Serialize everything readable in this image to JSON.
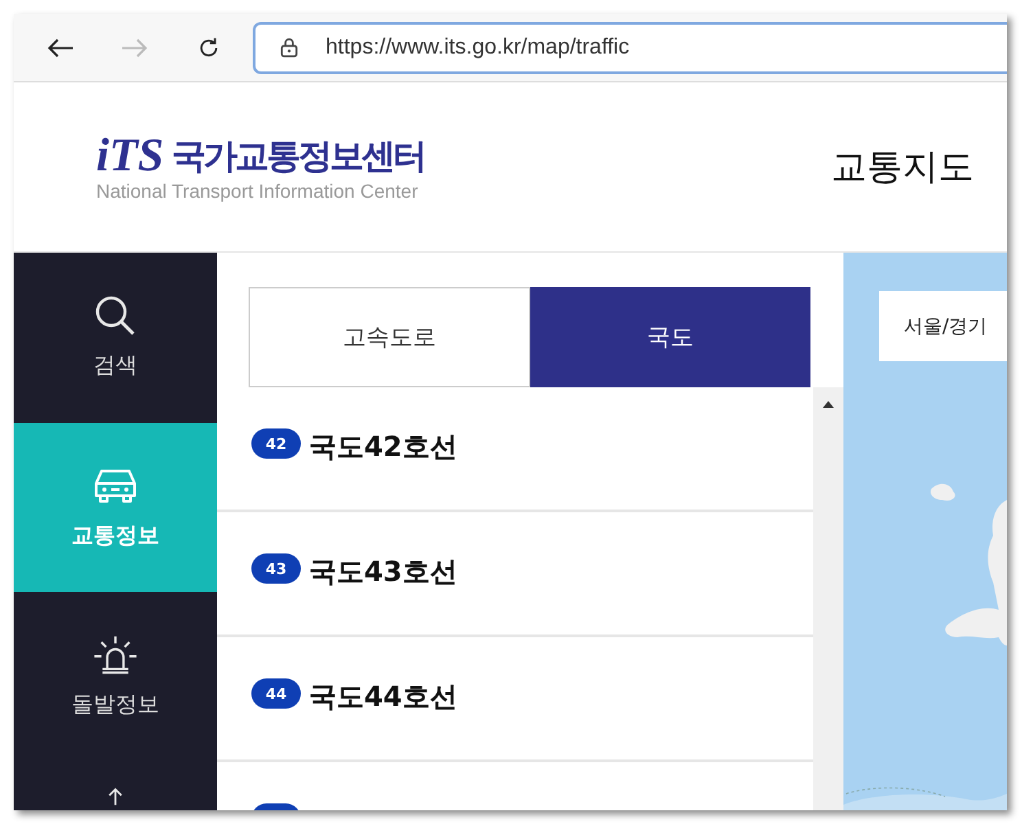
{
  "browser": {
    "url": "https://www.its.go.kr/map/traffic"
  },
  "header": {
    "logo_mark": "iTS",
    "org_name": "국가교통정보센터",
    "org_name_en": "National Transport Information Center",
    "page_title": "교통지도"
  },
  "sidebar": {
    "items": [
      {
        "kind": "search",
        "label": "검색",
        "selected": false
      },
      {
        "kind": "car",
        "label": "교통정보",
        "selected": true
      },
      {
        "kind": "alarm",
        "label": "돌발정보",
        "selected": false
      },
      {
        "kind": "upload",
        "selected": false
      }
    ]
  },
  "tabs": [
    {
      "label": "고속도로",
      "selected": false
    },
    {
      "label": "국도",
      "selected": true
    }
  ],
  "routes": [
    {
      "number": "42",
      "name": "국도42호선"
    },
    {
      "number": "43",
      "name": "국도43호선"
    },
    {
      "number": "44",
      "name": "국도44호선"
    }
  ],
  "map": {
    "region_button": "서울/경기"
  }
}
